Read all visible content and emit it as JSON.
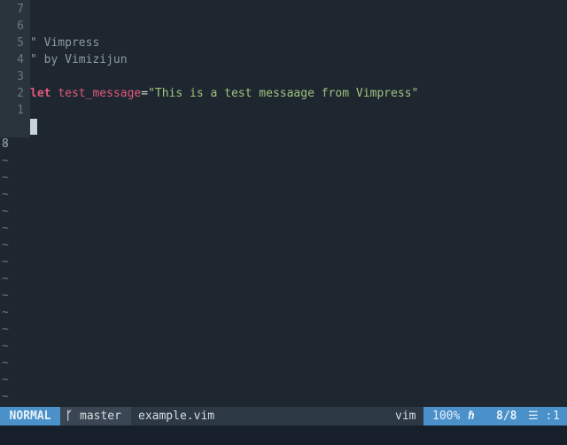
{
  "editor": {
    "lines": [
      {
        "num": "7",
        "parts": []
      },
      {
        "num": "6",
        "parts": []
      },
      {
        "num": "5",
        "parts": [
          {
            "cls": "comment",
            "text": "\" Vimpress"
          }
        ]
      },
      {
        "num": "4",
        "parts": [
          {
            "cls": "comment",
            "text": "\" by Vimizijun"
          }
        ]
      },
      {
        "num": "3",
        "parts": []
      },
      {
        "num": "2",
        "parts": [
          {
            "cls": "kw",
            "text": "let"
          },
          {
            "cls": "op",
            "text": " "
          },
          {
            "cls": "ident",
            "text": "test_message"
          },
          {
            "cls": "op",
            "text": "="
          },
          {
            "cls": "str",
            "text": "\"This is a test messaage from Vimpress\""
          }
        ]
      },
      {
        "num": "1",
        "parts": []
      }
    ],
    "current_line": {
      "num": "8"
    },
    "tilde": "~",
    "tilde_count": 16
  },
  "statusline": {
    "mode": "NORMAL",
    "branch_icon": "ᚴ",
    "branch": "master",
    "filename": "example.vim",
    "filetype": "vim",
    "percent": "100%",
    "line_icon": "ℏ",
    "position": "8/8",
    "col_icon": "☰ :",
    "column": "1"
  },
  "colors": {
    "background": "#1e2730",
    "mode_bg": "#4a90c9",
    "keyword": "#e0587a",
    "string": "#9ec27f",
    "comment": "#8d989f"
  }
}
